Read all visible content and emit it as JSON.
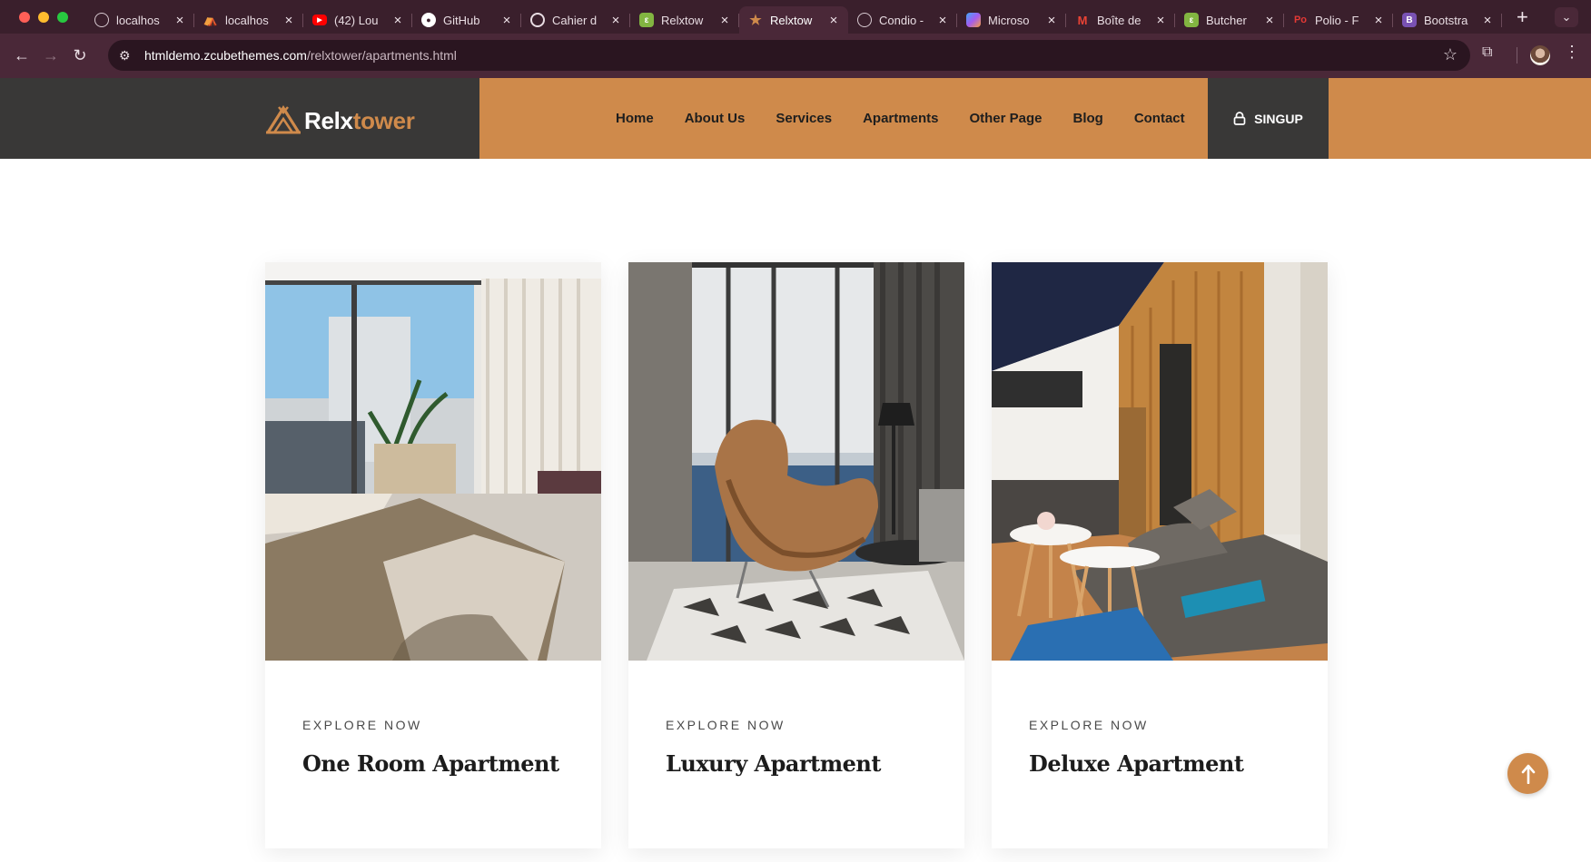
{
  "browser": {
    "tabs": [
      {
        "title": "localhos",
        "favicon": "globe-icon",
        "color": "#5f6368"
      },
      {
        "title": "localhos",
        "favicon": "tent-logo-icon",
        "color": "#cf8a4b"
      },
      {
        "title": "(42) Lou",
        "favicon": "youtube-icon",
        "color": "#ff0000"
      },
      {
        "title": "GitHub",
        "favicon": "github-icon",
        "color": "#ffffff"
      },
      {
        "title": "Cahier d",
        "favicon": "openai-icon",
        "color": "#ffffff"
      },
      {
        "title": "Relxtow",
        "favicon": "envato-icon",
        "color": "#82b541"
      },
      {
        "title": "Relxtow",
        "favicon": "star-icon",
        "color": "#cf8a4b",
        "active": true
      },
      {
        "title": "Condio -",
        "favicon": "globe-icon",
        "color": "#5f6368"
      },
      {
        "title": "Microso",
        "favicon": "copilot-icon",
        "color": "#7b68ee"
      },
      {
        "title": "Boîte de",
        "favicon": "gmail-icon",
        "color": "#ea4335"
      },
      {
        "title": "Butcher",
        "favicon": "envato-icon",
        "color": "#82b541"
      },
      {
        "title": "Polio - F",
        "favicon": "polio-icon",
        "color": "#e53935"
      },
      {
        "title": "Bootstra",
        "favicon": "bootstrap-icon",
        "color": "#7952b3"
      }
    ],
    "url_domain": "htmldemo.zcubethemes.com",
    "url_path": "/relxtower/apartments.html"
  },
  "site": {
    "logo": {
      "part1": "Relx",
      "part2": "tower"
    },
    "menu": [
      "Home",
      "About Us",
      "Services",
      "Apartments",
      "Other Page",
      "Blog",
      "Contact"
    ],
    "signup_label": "SINGUP"
  },
  "cards": [
    {
      "eyebrow": "EXPLORE NOW",
      "title": "One Room Apartment"
    },
    {
      "eyebrow": "EXPLORE NOW",
      "title": "Luxury Apartment"
    },
    {
      "eyebrow": "EXPLORE NOW",
      "title": "Deluxe Apartment"
    }
  ],
  "colors": {
    "accent": "#cf8a4b",
    "dark": "#393837",
    "browser_frame": "#3a1f2c"
  }
}
